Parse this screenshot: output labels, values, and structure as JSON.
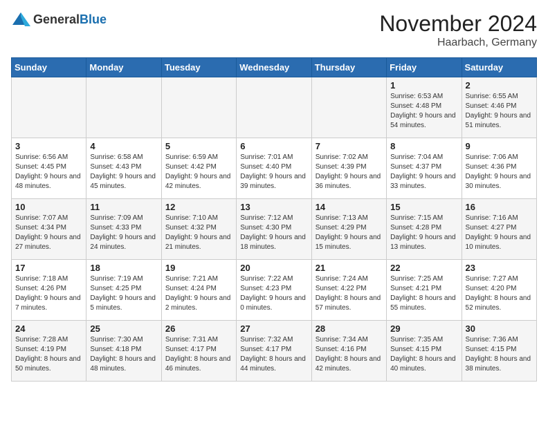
{
  "logo": {
    "general": "General",
    "blue": "Blue"
  },
  "title": "November 2024",
  "location": "Haarbach, Germany",
  "weekdays": [
    "Sunday",
    "Monday",
    "Tuesday",
    "Wednesday",
    "Thursday",
    "Friday",
    "Saturday"
  ],
  "weeks": [
    [
      {
        "day": "",
        "info": ""
      },
      {
        "day": "",
        "info": ""
      },
      {
        "day": "",
        "info": ""
      },
      {
        "day": "",
        "info": ""
      },
      {
        "day": "",
        "info": ""
      },
      {
        "day": "1",
        "info": "Sunrise: 6:53 AM\nSunset: 4:48 PM\nDaylight: 9 hours\nand 54 minutes."
      },
      {
        "day": "2",
        "info": "Sunrise: 6:55 AM\nSunset: 4:46 PM\nDaylight: 9 hours\nand 51 minutes."
      }
    ],
    [
      {
        "day": "3",
        "info": "Sunrise: 6:56 AM\nSunset: 4:45 PM\nDaylight: 9 hours\nand 48 minutes."
      },
      {
        "day": "4",
        "info": "Sunrise: 6:58 AM\nSunset: 4:43 PM\nDaylight: 9 hours\nand 45 minutes."
      },
      {
        "day": "5",
        "info": "Sunrise: 6:59 AM\nSunset: 4:42 PM\nDaylight: 9 hours\nand 42 minutes."
      },
      {
        "day": "6",
        "info": "Sunrise: 7:01 AM\nSunset: 4:40 PM\nDaylight: 9 hours\nand 39 minutes."
      },
      {
        "day": "7",
        "info": "Sunrise: 7:02 AM\nSunset: 4:39 PM\nDaylight: 9 hours\nand 36 minutes."
      },
      {
        "day": "8",
        "info": "Sunrise: 7:04 AM\nSunset: 4:37 PM\nDaylight: 9 hours\nand 33 minutes."
      },
      {
        "day": "9",
        "info": "Sunrise: 7:06 AM\nSunset: 4:36 PM\nDaylight: 9 hours\nand 30 minutes."
      }
    ],
    [
      {
        "day": "10",
        "info": "Sunrise: 7:07 AM\nSunset: 4:34 PM\nDaylight: 9 hours\nand 27 minutes."
      },
      {
        "day": "11",
        "info": "Sunrise: 7:09 AM\nSunset: 4:33 PM\nDaylight: 9 hours\nand 24 minutes."
      },
      {
        "day": "12",
        "info": "Sunrise: 7:10 AM\nSunset: 4:32 PM\nDaylight: 9 hours\nand 21 minutes."
      },
      {
        "day": "13",
        "info": "Sunrise: 7:12 AM\nSunset: 4:30 PM\nDaylight: 9 hours\nand 18 minutes."
      },
      {
        "day": "14",
        "info": "Sunrise: 7:13 AM\nSunset: 4:29 PM\nDaylight: 9 hours\nand 15 minutes."
      },
      {
        "day": "15",
        "info": "Sunrise: 7:15 AM\nSunset: 4:28 PM\nDaylight: 9 hours\nand 13 minutes."
      },
      {
        "day": "16",
        "info": "Sunrise: 7:16 AM\nSunset: 4:27 PM\nDaylight: 9 hours\nand 10 minutes."
      }
    ],
    [
      {
        "day": "17",
        "info": "Sunrise: 7:18 AM\nSunset: 4:26 PM\nDaylight: 9 hours\nand 7 minutes."
      },
      {
        "day": "18",
        "info": "Sunrise: 7:19 AM\nSunset: 4:25 PM\nDaylight: 9 hours\nand 5 minutes."
      },
      {
        "day": "19",
        "info": "Sunrise: 7:21 AM\nSunset: 4:24 PM\nDaylight: 9 hours\nand 2 minutes."
      },
      {
        "day": "20",
        "info": "Sunrise: 7:22 AM\nSunset: 4:23 PM\nDaylight: 9 hours\nand 0 minutes."
      },
      {
        "day": "21",
        "info": "Sunrise: 7:24 AM\nSunset: 4:22 PM\nDaylight: 8 hours\nand 57 minutes."
      },
      {
        "day": "22",
        "info": "Sunrise: 7:25 AM\nSunset: 4:21 PM\nDaylight: 8 hours\nand 55 minutes."
      },
      {
        "day": "23",
        "info": "Sunrise: 7:27 AM\nSunset: 4:20 PM\nDaylight: 8 hours\nand 52 minutes."
      }
    ],
    [
      {
        "day": "24",
        "info": "Sunrise: 7:28 AM\nSunset: 4:19 PM\nDaylight: 8 hours\nand 50 minutes."
      },
      {
        "day": "25",
        "info": "Sunrise: 7:30 AM\nSunset: 4:18 PM\nDaylight: 8 hours\nand 48 minutes."
      },
      {
        "day": "26",
        "info": "Sunrise: 7:31 AM\nSunset: 4:17 PM\nDaylight: 8 hours\nand 46 minutes."
      },
      {
        "day": "27",
        "info": "Sunrise: 7:32 AM\nSunset: 4:17 PM\nDaylight: 8 hours\nand 44 minutes."
      },
      {
        "day": "28",
        "info": "Sunrise: 7:34 AM\nSunset: 4:16 PM\nDaylight: 8 hours\nand 42 minutes."
      },
      {
        "day": "29",
        "info": "Sunrise: 7:35 AM\nSunset: 4:15 PM\nDaylight: 8 hours\nand 40 minutes."
      },
      {
        "day": "30",
        "info": "Sunrise: 7:36 AM\nSunset: 4:15 PM\nDaylight: 8 hours\nand 38 minutes."
      }
    ]
  ]
}
